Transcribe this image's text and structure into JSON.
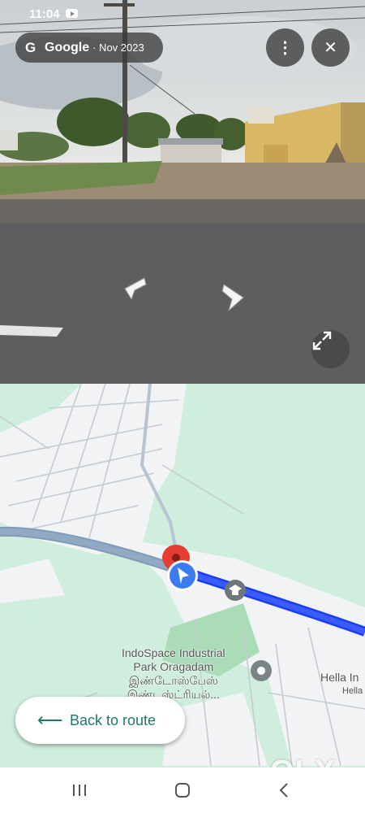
{
  "status_bar": {
    "time": "11:04"
  },
  "street_view": {
    "provider": "Google",
    "date": "· Nov 2023",
    "menu_label": "⋮",
    "close_label": "✕"
  },
  "map": {
    "place_name_line1": "IndoSpace Industrial",
    "place_name_line2": "Park Oragadam",
    "place_name_tamil1": "இண்டோஸ்பேஸ்",
    "place_name_tamil2": "இண்டஸ்ட்ரியல்...",
    "poi_right": "Hella In",
    "poi_right_sub": "Hella"
  },
  "back_to_route": {
    "arrow": "⟵",
    "label": "Back to route"
  },
  "watermark": "OLX",
  "colors": {
    "route": "#1a3cf5",
    "accent": "#1a7a6e",
    "map_bg": "#cfeede"
  }
}
